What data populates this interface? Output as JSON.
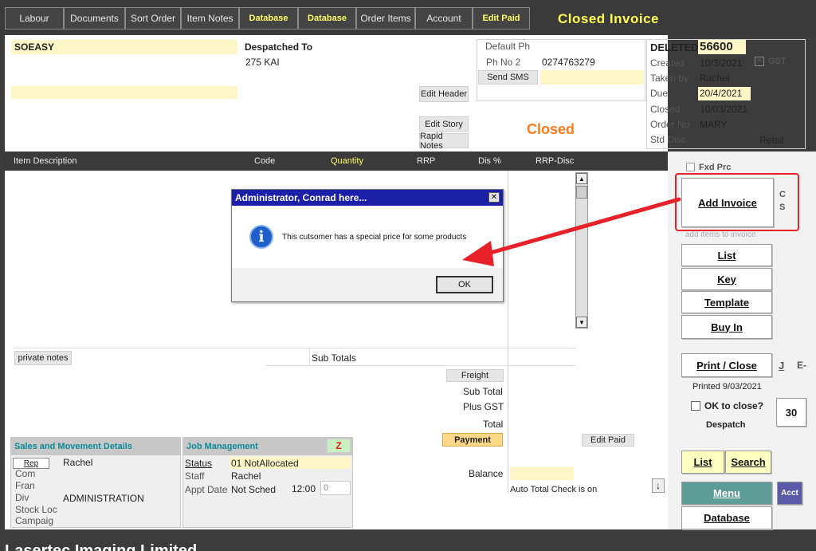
{
  "tabs": [
    {
      "label": "Labour",
      "highlight": false
    },
    {
      "label": "Documents",
      "highlight": false
    },
    {
      "label": "Sort Order",
      "highlight": false
    },
    {
      "label": "Item Notes",
      "highlight": false
    },
    {
      "label": "Database",
      "highlight": true
    },
    {
      "label": "Database",
      "highlight": true
    },
    {
      "label": "Order Items",
      "highlight": false
    },
    {
      "label": "Account",
      "highlight": false
    },
    {
      "label": "Edit Paid",
      "highlight": true
    }
  ],
  "window_title": "Closed  Invoice",
  "customer": {
    "name": "SOEASY",
    "despatched_label": "Despatched To",
    "despatched_address": "275 KAI"
  },
  "header_buttons": {
    "edit_header": "Edit Header",
    "edit_story": "Edit Story",
    "rapid_notes": "Rapid Notes"
  },
  "phones": {
    "default_label": "Default Ph",
    "ph2_label": "Ph No 2",
    "ph2_value": "0274763279",
    "send_sms": "Send SMS"
  },
  "status_big": "Closed",
  "invoice": {
    "deleted_label": "DELETED",
    "number": "56600",
    "created_label": "Created",
    "created": "10/3/2021",
    "gst_label": "GST",
    "taken_label": "Taken by",
    "taken": "Rachel",
    "due_label": "Due",
    "due": "20/4/2021",
    "closed_label": "Closed",
    "closed": "10/03/2021",
    "order_label": "Order No",
    "order": "MARY",
    "std_disc_label": "Std Disc",
    "std_disc": "Retail"
  },
  "grid_columns": {
    "desc": "Item Description",
    "code": "Code",
    "qty": "Quantity",
    "rrp": "RRP",
    "dis": "Dis %",
    "rrp_disc": "RRP-Disc"
  },
  "dialog": {
    "title": "Administrator, Conrad here...",
    "close": "✕",
    "message": "This cutsomer has a special price for some products",
    "ok": "OK"
  },
  "notes": {
    "private_notes": "private notes",
    "sub_totals": "Sub Totals"
  },
  "totals": {
    "freight": "Freight",
    "sub_total": "Sub Total",
    "plus_gst": "Plus GST",
    "total": "Total",
    "payment": "Payment",
    "balance": "Balance",
    "edit_paid": "Edit Paid",
    "auto_check": "Auto Total Check is on"
  },
  "right": {
    "fxd_prc": "Fxd Prc",
    "add_invoice": "Add Invoice",
    "cs": "C\nS",
    "add_hint": "add items to invoice",
    "list": "List",
    "key": "Key",
    "template": "Template",
    "buy_in": "Buy In",
    "print_close": "Print / Close",
    "j": "J",
    "e": "E-",
    "printed": "Printed  9/03/2021",
    "ok_close": "OK to close?",
    "despatch": "Despatch",
    "days": "30",
    "list2": "List",
    "search": "Search",
    "menu": "Menu",
    "acct": "Acct",
    "database": "Database"
  },
  "sales": {
    "title": "Sales and Movement Details",
    "rep_btn": "Rep",
    "rep": "Rachel",
    "com": "Com",
    "fran": "Fran",
    "div": "Div",
    "div_val": "ADMINISTRATION",
    "stock": "Stock Loc",
    "campaign": "Campaig"
  },
  "job": {
    "title": "Job Management",
    "z": "Z",
    "status_label": "Status",
    "status": "01 NotAllocated",
    "staff_label": "Staff",
    "staff": "Rachel",
    "appt_label": "Appt Date",
    "appt": "Not Sched",
    "time": "12:00",
    "dur": "0"
  },
  "footer": "Lasertec Imaging Limited",
  "colors": {
    "accent_yellow": "#ffff55",
    "closed_orange": "#ff7a1a",
    "highlight_red": "#e8202a",
    "dialog_title": "#1c1fa8",
    "menu_teal": "#5e9c98"
  }
}
